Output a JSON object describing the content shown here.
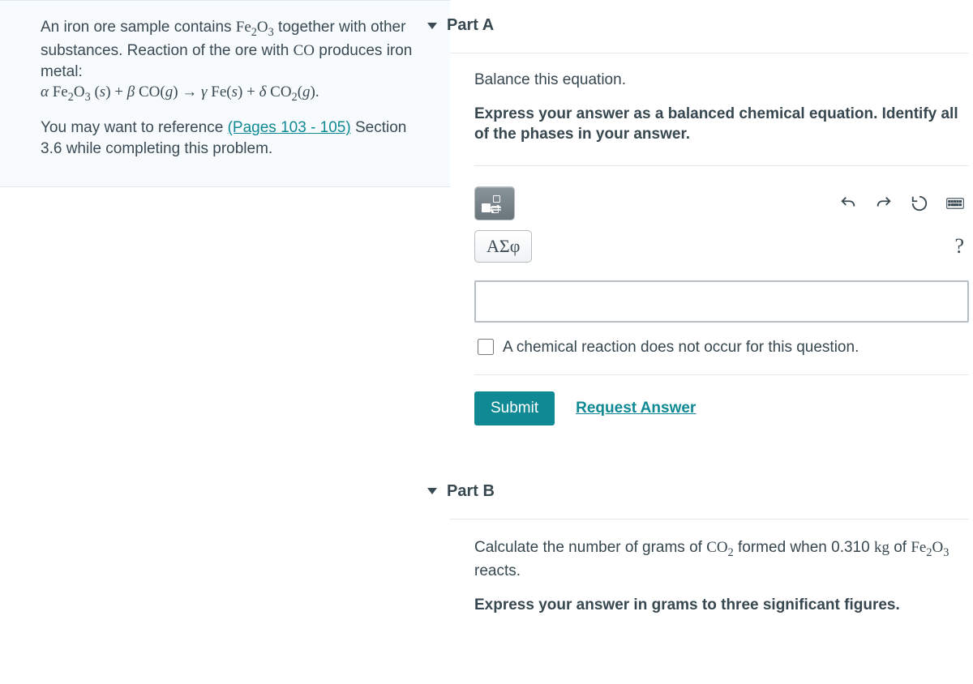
{
  "problem": {
    "intro_1": "An iron ore sample contains ",
    "fe2o3": "Fe",
    "intro_2": " together with other substances. Reaction of the ore with ",
    "co": "CO",
    "intro_3": " produces iron metal:",
    "equation": {
      "alpha": "α",
      "fe2o3_s": "Fe",
      "plus": " + ",
      "beta": "β",
      "co_g": "CO(g)",
      "arrow": " → ",
      "gamma": "γ",
      "fe_s": "Fe(s)",
      "delta": "δ",
      "co2_g": "CO",
      "end": "(g)."
    },
    "ref_1": "You may want to reference ",
    "ref_link": "(Pages 103 - 105)",
    "ref_2": " Section 3.6 while completing this problem."
  },
  "partA": {
    "title": "Part A",
    "instruction": "Balance this equation.",
    "directive": "Express your answer as a balanced chemical equation. Identify all of the phases in your answer.",
    "greek_btn": "ΑΣφ",
    "help_btn": "?",
    "checkbox_label": "A chemical reaction does not occur for this question.",
    "submit": "Submit",
    "request": "Request Answer"
  },
  "partB": {
    "title": "Part B",
    "q_1": "Calculate the number of grams of ",
    "co2": "CO",
    "q_2": " formed when 0.310 ",
    "kg": "kg",
    "q_3": " of ",
    "fe2o3": "Fe",
    "q_4": " reacts.",
    "directive": "Express your answer in grams to three significant figures."
  }
}
